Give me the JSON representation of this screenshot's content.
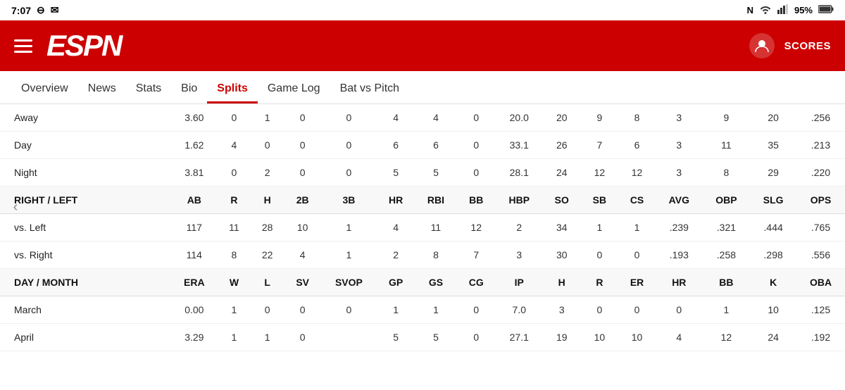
{
  "statusBar": {
    "time": "7:07",
    "icons": [
      "minus-circle-icon",
      "mail-icon",
      "nfc-icon",
      "wifi-icon",
      "signal-icon"
    ],
    "battery": "95%"
  },
  "header": {
    "logoText": "ESPN",
    "scoresLabel": "SCORES"
  },
  "nav": {
    "tabs": [
      {
        "label": "Overview",
        "active": false
      },
      {
        "label": "News",
        "active": false
      },
      {
        "label": "Stats",
        "active": false
      },
      {
        "label": "Bio",
        "active": false
      },
      {
        "label": "Splits",
        "active": true
      },
      {
        "label": "Game Log",
        "active": false
      },
      {
        "label": "Bat vs Pitch",
        "active": false
      }
    ]
  },
  "sections": [
    {
      "type": "data",
      "rows": [
        {
          "label": "Away",
          "cols": [
            "3.60",
            "0",
            "1",
            "0",
            "0",
            "4",
            "4",
            "0",
            "20.0",
            "20",
            "9",
            "8",
            "3",
            "9",
            "20",
            ".256"
          ]
        },
        {
          "label": "Day",
          "cols": [
            "1.62",
            "4",
            "0",
            "0",
            "0",
            "6",
            "6",
            "0",
            "33.1",
            "26",
            "7",
            "6",
            "3",
            "11",
            "35",
            ".213"
          ]
        },
        {
          "label": "Night",
          "cols": [
            "3.81",
            "0",
            "2",
            "0",
            "0",
            "5",
            "5",
            "0",
            "28.1",
            "24",
            "12",
            "12",
            "3",
            "8",
            "29",
            ".220"
          ]
        }
      ]
    },
    {
      "type": "header",
      "label": "RIGHT / LEFT",
      "cols": [
        "AB",
        "R",
        "H",
        "2B",
        "3B",
        "HR",
        "RBI",
        "BB",
        "HBP",
        "SO",
        "SB",
        "CS",
        "AVG",
        "OBP",
        "SLG",
        "OPS"
      ]
    },
    {
      "type": "data",
      "rows": [
        {
          "label": "vs. Left",
          "cols": [
            "117",
            "11",
            "28",
            "10",
            "1",
            "4",
            "11",
            "12",
            "2",
            "34",
            "1",
            "1",
            ".239",
            ".321",
            ".444",
            ".765"
          ]
        },
        {
          "label": "vs. Right",
          "cols": [
            "114",
            "8",
            "22",
            "4",
            "1",
            "2",
            "8",
            "7",
            "3",
            "30",
            "0",
            "0",
            ".193",
            ".258",
            ".298",
            ".556"
          ]
        }
      ]
    },
    {
      "type": "header",
      "label": "DAY / MONTH",
      "cols": [
        "ERA",
        "W",
        "L",
        "SV",
        "SVOP",
        "GP",
        "GS",
        "CG",
        "IP",
        "H",
        "R",
        "ER",
        "HR",
        "BB",
        "K",
        "OBA"
      ]
    },
    {
      "type": "data",
      "rows": [
        {
          "label": "March",
          "cols": [
            "0.00",
            "1",
            "0",
            "0",
            "0",
            "1",
            "1",
            "0",
            "7.0",
            "3",
            "0",
            "0",
            "0",
            "1",
            "10",
            ".125"
          ]
        },
        {
          "label": "April",
          "cols": [
            "3.29",
            "1",
            "1",
            "0",
            "",
            "5",
            "5",
            "0",
            "27.1",
            "19",
            "10",
            "10",
            "4",
            "12",
            "24",
            ".192"
          ]
        }
      ]
    }
  ]
}
